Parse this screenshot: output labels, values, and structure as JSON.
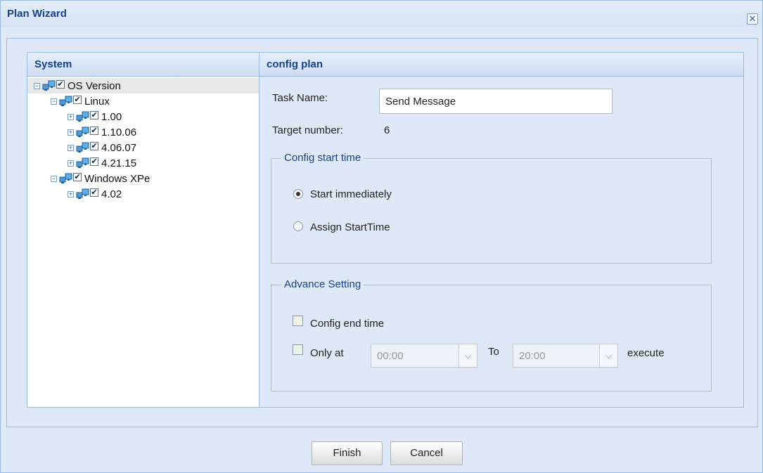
{
  "window": {
    "title": "Plan Wizard",
    "close_glyph": "✕"
  },
  "tree": {
    "header": "System",
    "nodes": [
      {
        "label": "OS Version",
        "toggle": "−",
        "checked": true,
        "icon": "computer-network-icon"
      },
      {
        "label": "Linux",
        "toggle": "−",
        "checked": true,
        "icon": "computer-network-icon"
      },
      {
        "label": "1.00",
        "toggle": "+",
        "checked": true,
        "icon": "computer-network-icon"
      },
      {
        "label": "1.10.06",
        "toggle": "+",
        "checked": true,
        "icon": "computer-network-icon"
      },
      {
        "label": "4.06.07",
        "toggle": "+",
        "checked": true,
        "icon": "computer-network-icon"
      },
      {
        "label": "4.21.15",
        "toggle": "+",
        "checked": true,
        "icon": "computer-network-icon"
      },
      {
        "label": "Windows XPe",
        "toggle": "−",
        "checked": true,
        "icon": "computer-network-icon"
      },
      {
        "label": "4.02",
        "toggle": "+",
        "checked": true,
        "icon": "computer-network-icon"
      }
    ]
  },
  "form": {
    "header": "config plan",
    "task_name_label": "Task Name:",
    "task_name_value": "Send Message",
    "target_number_label": "Target number:",
    "target_number_value": "6",
    "start_group": {
      "legend": "Config start time",
      "option_immediate": "Start immediately",
      "option_assign": "Assign StartTime",
      "selected": "immediate"
    },
    "advance_group": {
      "legend": "Advance Setting",
      "config_end_time_label": "Config end time",
      "only_at_label": "Only at",
      "from_time": "00:00",
      "to_label": "To",
      "to_time": "20:00",
      "execute_label": "execute"
    }
  },
  "buttons": {
    "finish": "Finish",
    "cancel": "Cancel"
  },
  "colors": {
    "title_text": "#15428b",
    "panel_background": "#dfe8f6",
    "border": "#99bbe8"
  }
}
